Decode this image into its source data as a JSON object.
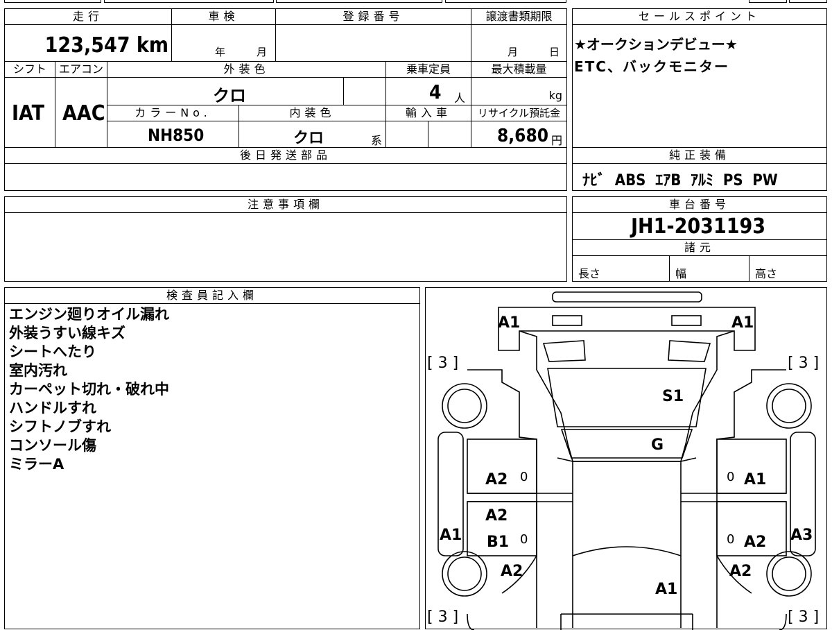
{
  "top": {
    "mileage_label": "走行",
    "mileage_value": "123,547 km",
    "inspection_label": "車検",
    "inspection_year": "年",
    "inspection_month": "月",
    "registration_label": "登録番号",
    "transfer_label": "譲渡書類期限",
    "transfer_month": "月",
    "transfer_day": "日",
    "shift_label": "シフト",
    "aircon_label": "エアコン",
    "exterior_color_label": "外装色",
    "capacity_label": "乗車定員",
    "max_load_label": "最大積載量",
    "shift_value": "IAT",
    "aircon_value": "AAC",
    "exterior_color_value": "クロ",
    "capacity_value": "4",
    "capacity_unit": "人",
    "max_load_unit": "kg",
    "color_no_label": "カラーNo.",
    "interior_color_label": "内装色",
    "import_label": "輸入車",
    "recycle_label": "リサイクル預託金",
    "color_no_value": "NH850",
    "interior_color_value": "クロ",
    "interior_color_suffix": "系",
    "recycle_value": "8,680",
    "recycle_unit": "円",
    "later_parts_label": "後日発送部品"
  },
  "sales": {
    "label": "セールスポイント",
    "line1": "★オークションデビュー★",
    "line2": "ETC、バックモニター"
  },
  "equipment": {
    "label": "純正装備",
    "items": "ﾅﾋﾞ  ABS  ｴｱB  ｱﾙﾐ  PS  PW"
  },
  "caution": {
    "label": "注意事項欄"
  },
  "chassis": {
    "label": "車台番号",
    "value": "JH1-2031193",
    "spec_label": "諸元",
    "length_label": "長さ",
    "width_label": "幅",
    "height_label": "高さ"
  },
  "inspector": {
    "label": "検査員記入欄",
    "notes": [
      "エンジン廻りオイル漏れ",
      "外装うすい線キズ",
      "シートへたり",
      "室内汚れ",
      "カーペット切れ・破れ中",
      "ハンドルすれ",
      "シフトノブすれ",
      "コンソール傷",
      "ミラーA"
    ]
  },
  "diagram": {
    "front_left": "A1",
    "front_right": "A1",
    "bracket_tl": "[ 3 ]",
    "bracket_tr": "[ 3 ]",
    "bracket_bl": "[ 3 ]",
    "bracket_br": "[ 3 ]",
    "windshield": "S1",
    "hood_rear": "G",
    "left_door_front": "A2",
    "left_door_rear_1": "A2",
    "left_door_rear_2": "B1",
    "right_door_front": "A1",
    "right_door_rear": "A2",
    "left_side": "A1",
    "right_side": "A3",
    "left_rear_fender": "A2",
    "right_rear_fender": "A2",
    "roof_rear": "A1",
    "zero_1": "0",
    "zero_2": "0",
    "zero_3": "0",
    "zero_4": "0"
  }
}
